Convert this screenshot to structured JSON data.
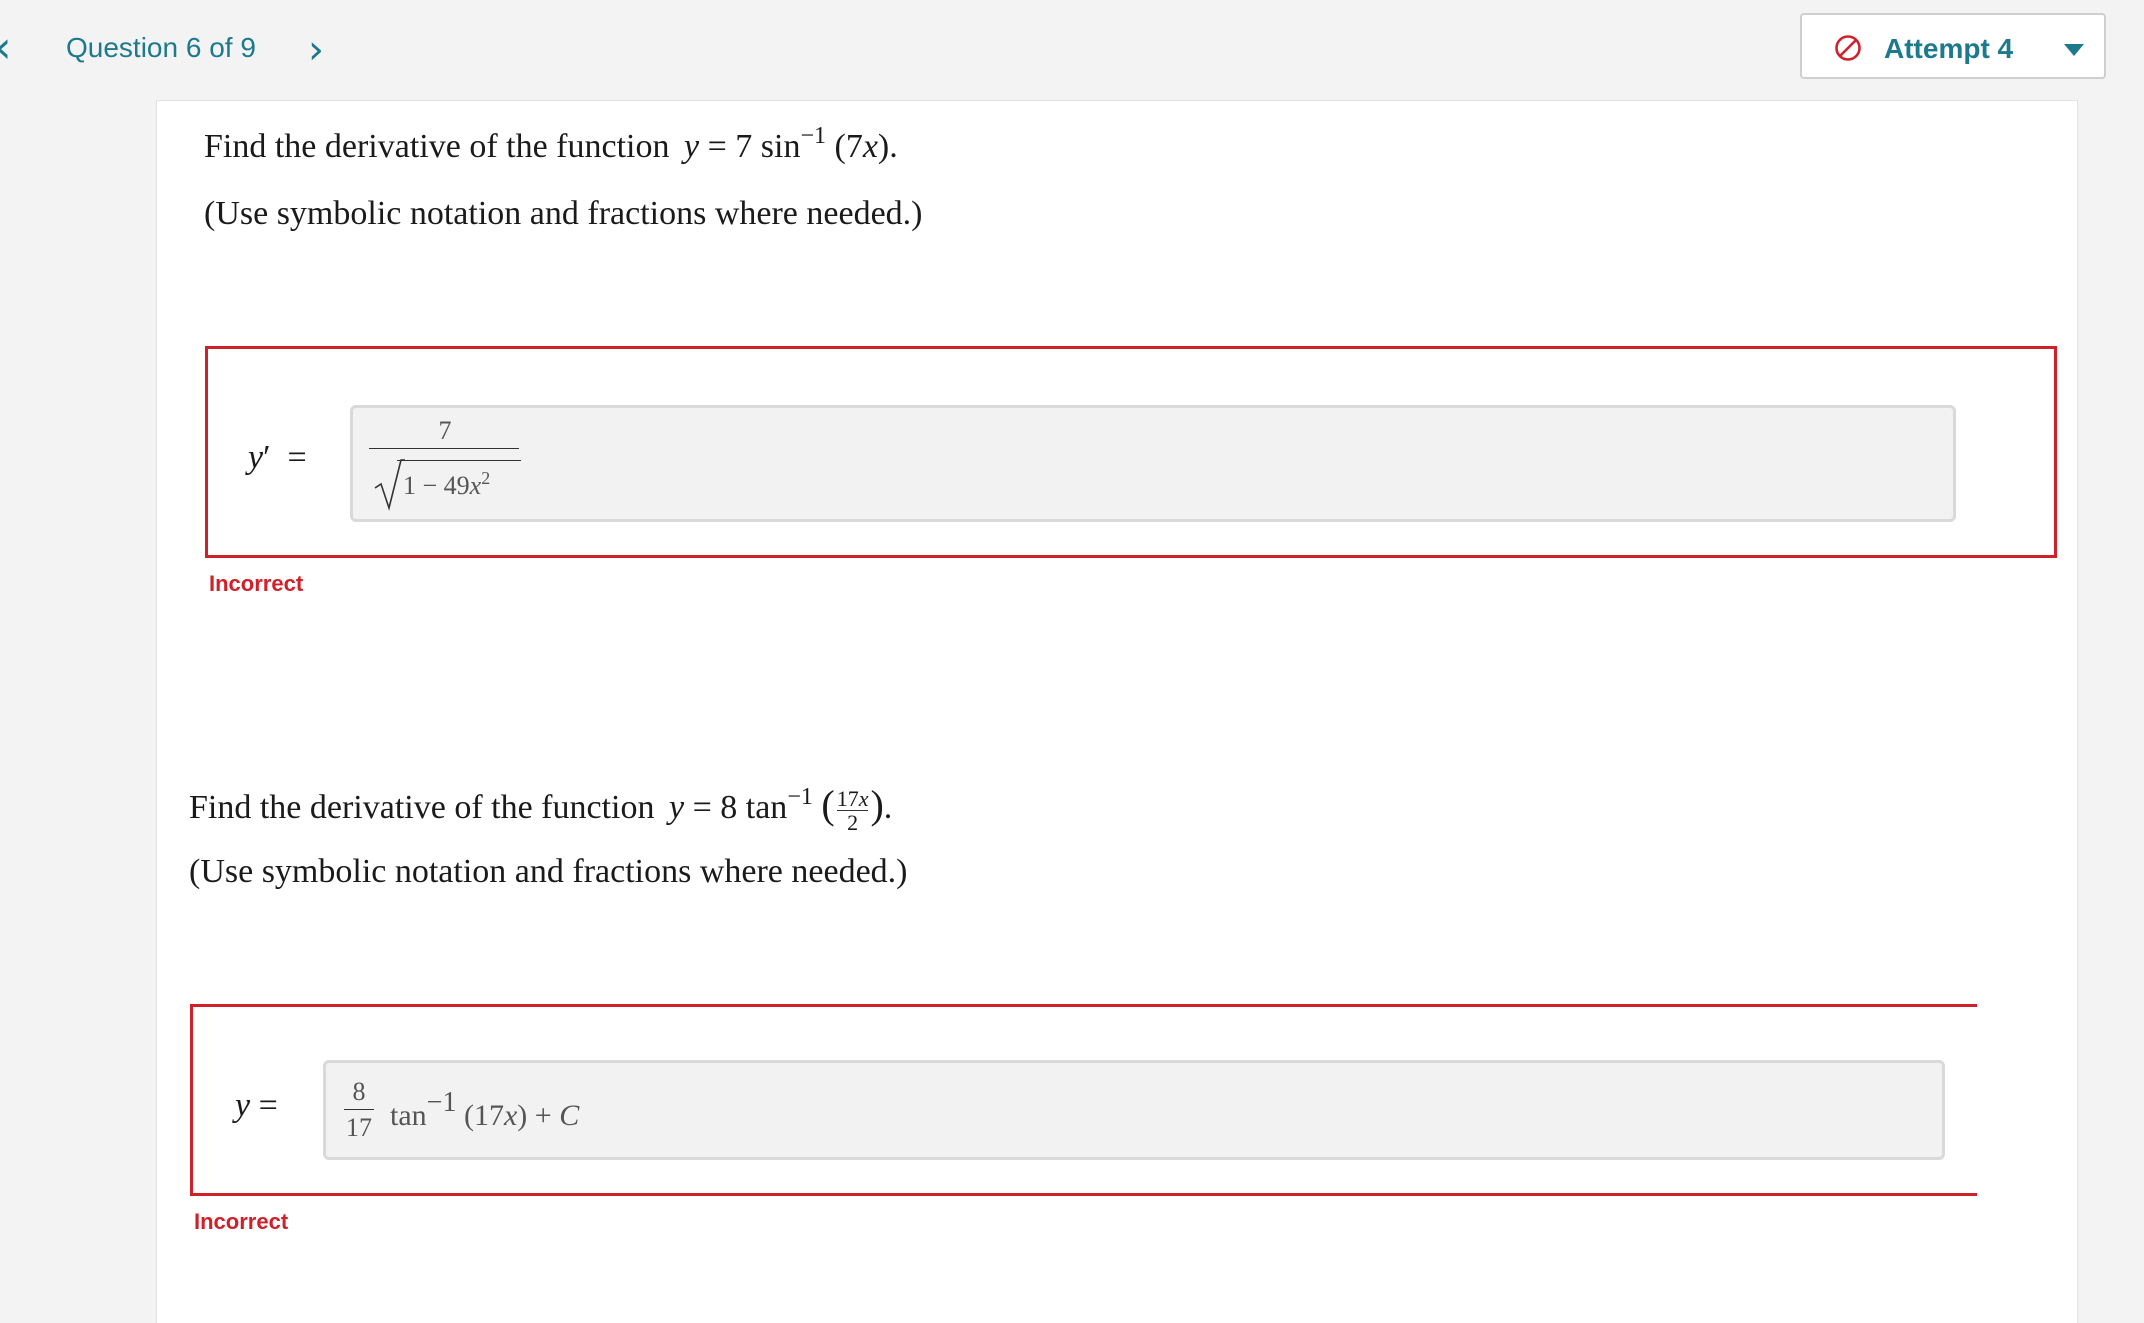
{
  "header": {
    "question_label": "Question 6 of 9",
    "attempt_label": "Attempt 4"
  },
  "problems": [
    {
      "prompt_prefix": "Find the derivative of the function",
      "function_display": "y = 7 sin⁻¹ (7x).",
      "note": "(Use symbolic notation and fractions where needed.)",
      "answer_lhs": "y′ =",
      "answer_numerator": "7",
      "answer_denominator": "1 − 49x²",
      "status": "Incorrect"
    },
    {
      "prompt_prefix": "Find the derivative of the function",
      "function_display": "y = 8 tan⁻¹ (17x/2).",
      "note": "(Use symbolic notation and fractions where needed.)",
      "answer_lhs": "y =",
      "answer_frac_numerator": "8",
      "answer_frac_denominator": "17",
      "answer_rest": "tan⁻¹ (17x) + C",
      "status": "Incorrect"
    }
  ],
  "colors": {
    "accent": "#1d7a8c",
    "error": "#d0202a",
    "page_bg": "#f3f3f3"
  }
}
